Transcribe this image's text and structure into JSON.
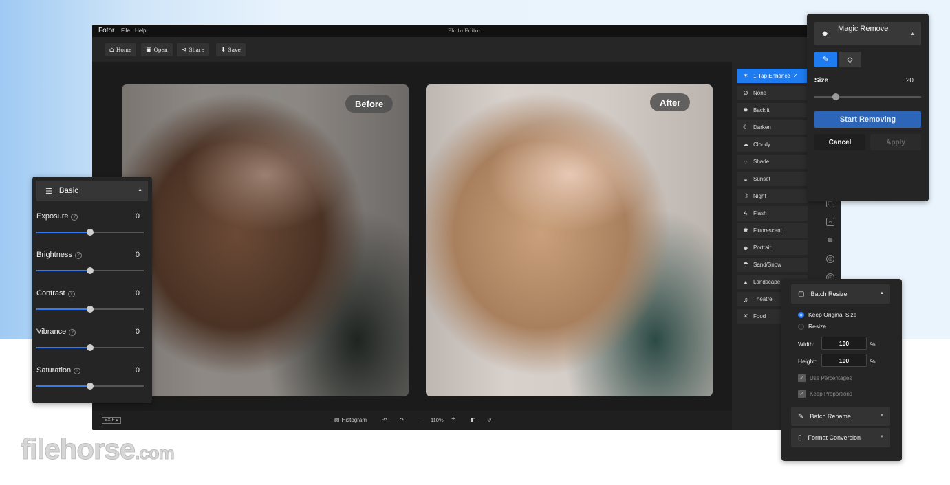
{
  "app": {
    "brand": "Fotor",
    "menu": [
      "File",
      "Help"
    ],
    "window_title": "Photo Editor"
  },
  "toolbar": {
    "home": {
      "label": "Home",
      "icon": "home-icon"
    },
    "open": {
      "label": "Open",
      "icon": "open-icon"
    },
    "share": {
      "label": "Share",
      "icon": "share-icon"
    },
    "save": {
      "label": "Save",
      "icon": "download-icon"
    }
  },
  "canvas": {
    "before_label": "Before",
    "after_label": "After"
  },
  "statusbar": {
    "exif": "EXIF",
    "histogram": "Histogram",
    "zoom": "110%"
  },
  "effects": {
    "items": [
      {
        "label": "1-Tap Enhance",
        "icon": "magic-wand-icon",
        "active": true
      },
      {
        "label": "None",
        "icon": "none-icon"
      },
      {
        "label": "Backlit",
        "icon": "backlit-icon"
      },
      {
        "label": "Darken",
        "icon": "moon-icon"
      },
      {
        "label": "Cloudy",
        "icon": "cloud-icon"
      },
      {
        "label": "Shade",
        "icon": "shade-icon"
      },
      {
        "label": "Sunset",
        "icon": "sunset-icon"
      },
      {
        "label": "Night",
        "icon": "night-icon"
      },
      {
        "label": "Flash",
        "icon": "flash-icon"
      },
      {
        "label": "Fluorescent",
        "icon": "fluorescent-icon"
      },
      {
        "label": "Portrait",
        "icon": "portrait-icon"
      },
      {
        "label": "Sand/Snow",
        "icon": "beach-icon"
      },
      {
        "label": "Landscape",
        "icon": "landscape-icon"
      },
      {
        "label": "Theatre",
        "icon": "music-icon"
      },
      {
        "label": "Food",
        "icon": "utensils-icon"
      }
    ]
  },
  "basic_panel": {
    "title": "Basic",
    "adjustments": [
      {
        "label": "Exposure",
        "value": "0",
        "level": 0.5
      },
      {
        "label": "Brightness",
        "value": "0",
        "level": 0.5
      },
      {
        "label": "Contrast",
        "value": "0",
        "level": 0.5
      },
      {
        "label": "Vibrance",
        "value": "0",
        "level": 0.5
      },
      {
        "label": "Saturation",
        "value": "0",
        "level": 0.5
      }
    ]
  },
  "magic_remove": {
    "title": "Magic Remove",
    "size_label": "Size",
    "size_value": "20",
    "size_level": 0.2,
    "start_label": "Start Removing",
    "cancel_label": "Cancel",
    "apply_label": "Apply"
  },
  "batch_panel": {
    "resize_title": "Batch Resize",
    "keep_original": "Keep Original Size",
    "resize": "Resize",
    "width_label": "Width:",
    "width_value": "100",
    "height_label": "Height:",
    "height_value": "100",
    "unit": "%",
    "use_percentages": "Use Percentages",
    "keep_proportions": "Keep Proportions",
    "rename_title": "Batch Rename",
    "format_title": "Format Conversion"
  },
  "watermark": {
    "text_main": "filehorse",
    "text_suffix": ".com"
  },
  "colors": {
    "accent": "#1f7bf0",
    "panel": "#252525",
    "start_button": "#2d66b8"
  }
}
